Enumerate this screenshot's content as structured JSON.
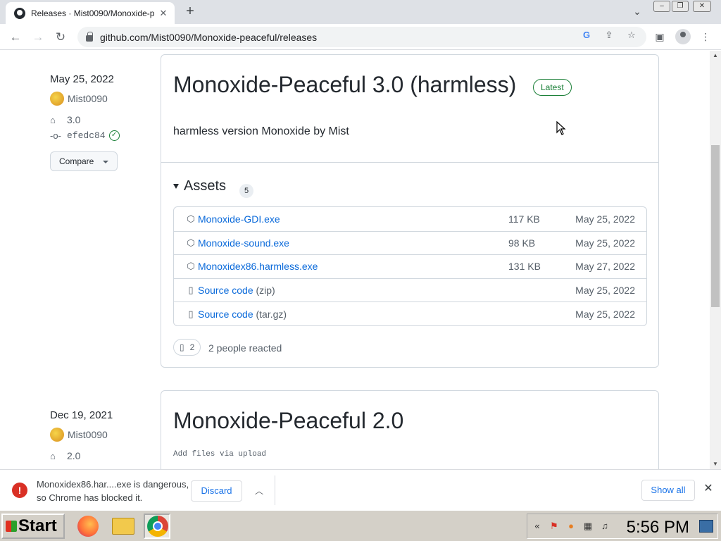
{
  "browser": {
    "tab_title": "Releases · Mist0090/Monoxide-p",
    "url": "github.com/Mist0090/Monoxide-peaceful/releases"
  },
  "release1": {
    "date": "May 25, 2022",
    "author": "Mist0090",
    "tag": "3.0",
    "commit": "efedc84",
    "compare_label": "Compare",
    "title": "Monoxide-Peaceful 3.0 (harmless)",
    "latest_label": "Latest",
    "description": "harmless version Monoxide by Mist",
    "assets_label": "Assets",
    "assets_count": "5",
    "assets": [
      {
        "name": "Monoxide-GDI.exe",
        "suffix": "",
        "size": "117 KB",
        "date": "May 25, 2022",
        "icon": "package-icon"
      },
      {
        "name": "Monoxide-sound.exe",
        "suffix": "",
        "size": "98 KB",
        "date": "May 25, 2022",
        "icon": "package-icon"
      },
      {
        "name": "Monoxidex86.harmless.exe",
        "suffix": "",
        "size": "131 KB",
        "date": "May 27, 2022",
        "icon": "package-icon"
      },
      {
        "name": "Source code",
        "suffix": " (zip)",
        "size": "",
        "date": "May 25, 2022",
        "icon": "file-zip-icon"
      },
      {
        "name": "Source code",
        "suffix": " (tar.gz)",
        "size": "",
        "date": "May 25, 2022",
        "icon": "file-zip-icon"
      }
    ],
    "reaction_count": "2",
    "reaction_text": "2 people reacted"
  },
  "release2": {
    "date": "Dec 19, 2021",
    "author": "Mist0090",
    "tag": "2.0",
    "title": "Monoxide-Peaceful 2.0",
    "description": "Add files via upload"
  },
  "download_bar": {
    "message_line1": "Monoxidex86.har....exe is dangerous,",
    "message_line2": "so Chrome has blocked it.",
    "discard_label": "Discard",
    "show_all_label": "Show all"
  },
  "taskbar": {
    "start_label": "Start",
    "clock": "5:56 PM"
  }
}
